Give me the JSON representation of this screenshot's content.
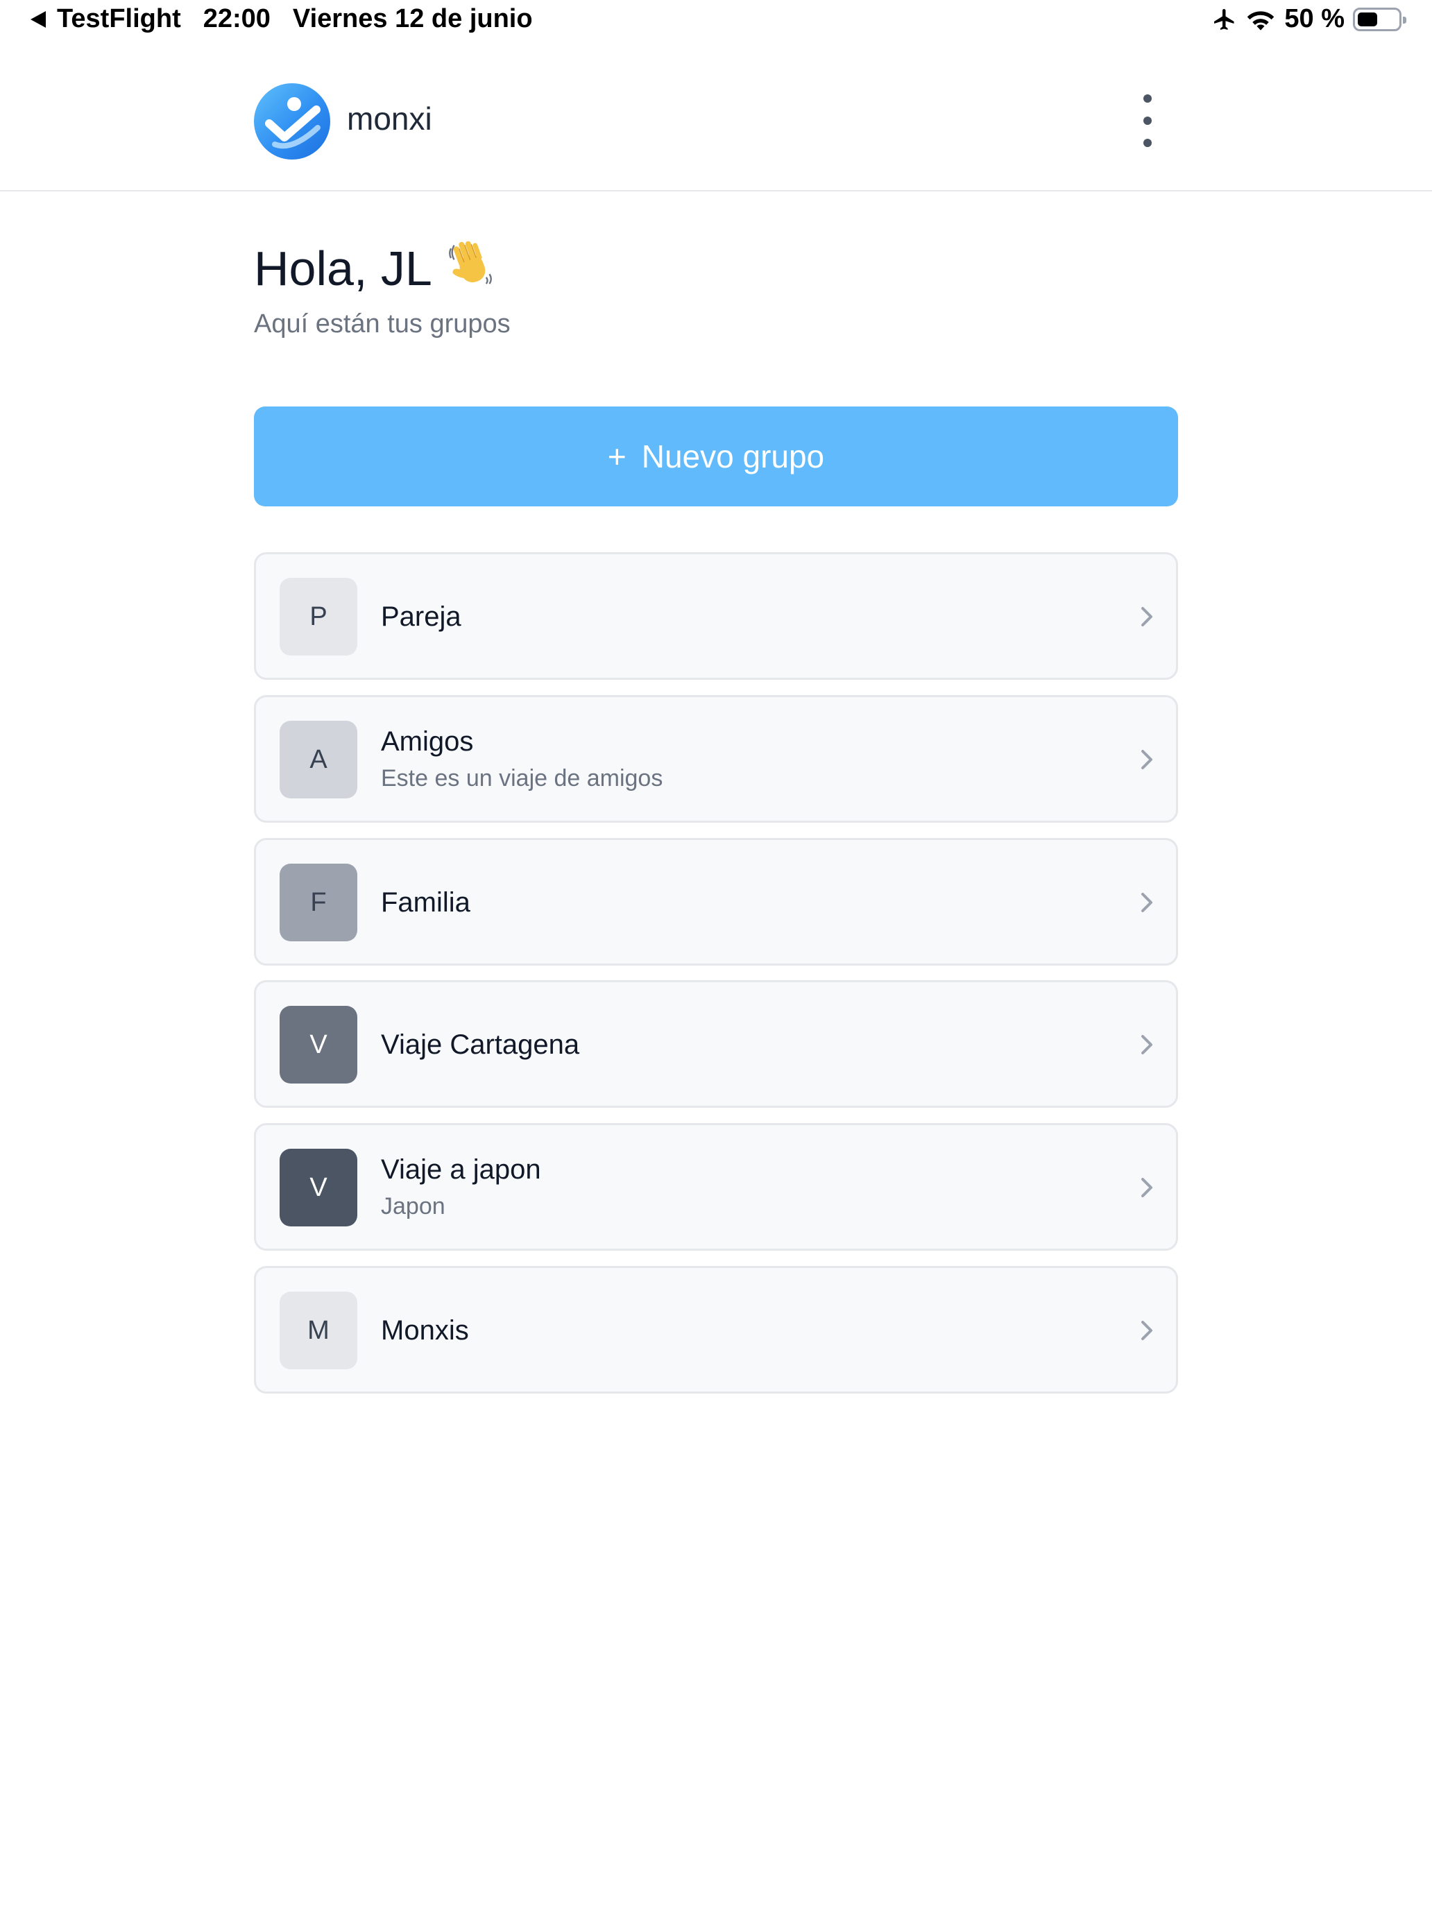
{
  "status_bar": {
    "back_app": "TestFlight",
    "time": "22:00",
    "date": "Viernes 12 de junio",
    "battery_percent": "50 %",
    "battery_level": 0.5,
    "icons": [
      "airplane-icon",
      "wifi-icon",
      "battery-icon"
    ]
  },
  "header": {
    "brand": "monxi",
    "logo_icon": "monxi-logo",
    "menu_icon": "kebab-menu-icon"
  },
  "greeting": {
    "title": "Hola, JL",
    "emoji": "👋",
    "subtitle": "Aquí están tus grupos"
  },
  "new_group_button": {
    "icon": "+",
    "label": "Nuevo grupo",
    "color": "#61bafb"
  },
  "groups": [
    {
      "initial": "P",
      "name": "Pareja",
      "description": "",
      "avatar_bg": "#e5e7eb",
      "avatar_fg": "#374151"
    },
    {
      "initial": "A",
      "name": "Amigos",
      "description": "Este es un viaje de amigos",
      "avatar_bg": "#d1d5db",
      "avatar_fg": "#374151"
    },
    {
      "initial": "F",
      "name": "Familia",
      "description": "",
      "avatar_bg": "#9ca3af",
      "avatar_fg": "#374151"
    },
    {
      "initial": "V",
      "name": "Viaje Cartagena",
      "description": "",
      "avatar_bg": "#6b7280",
      "avatar_fg": "#ffffff"
    },
    {
      "initial": "V",
      "name": "Viaje a japon",
      "description": "Japon",
      "avatar_bg": "#4b5563",
      "avatar_fg": "#ffffff"
    },
    {
      "initial": "M",
      "name": "Monxis",
      "description": "",
      "avatar_bg": "#e5e7eb",
      "avatar_fg": "#374151"
    }
  ]
}
